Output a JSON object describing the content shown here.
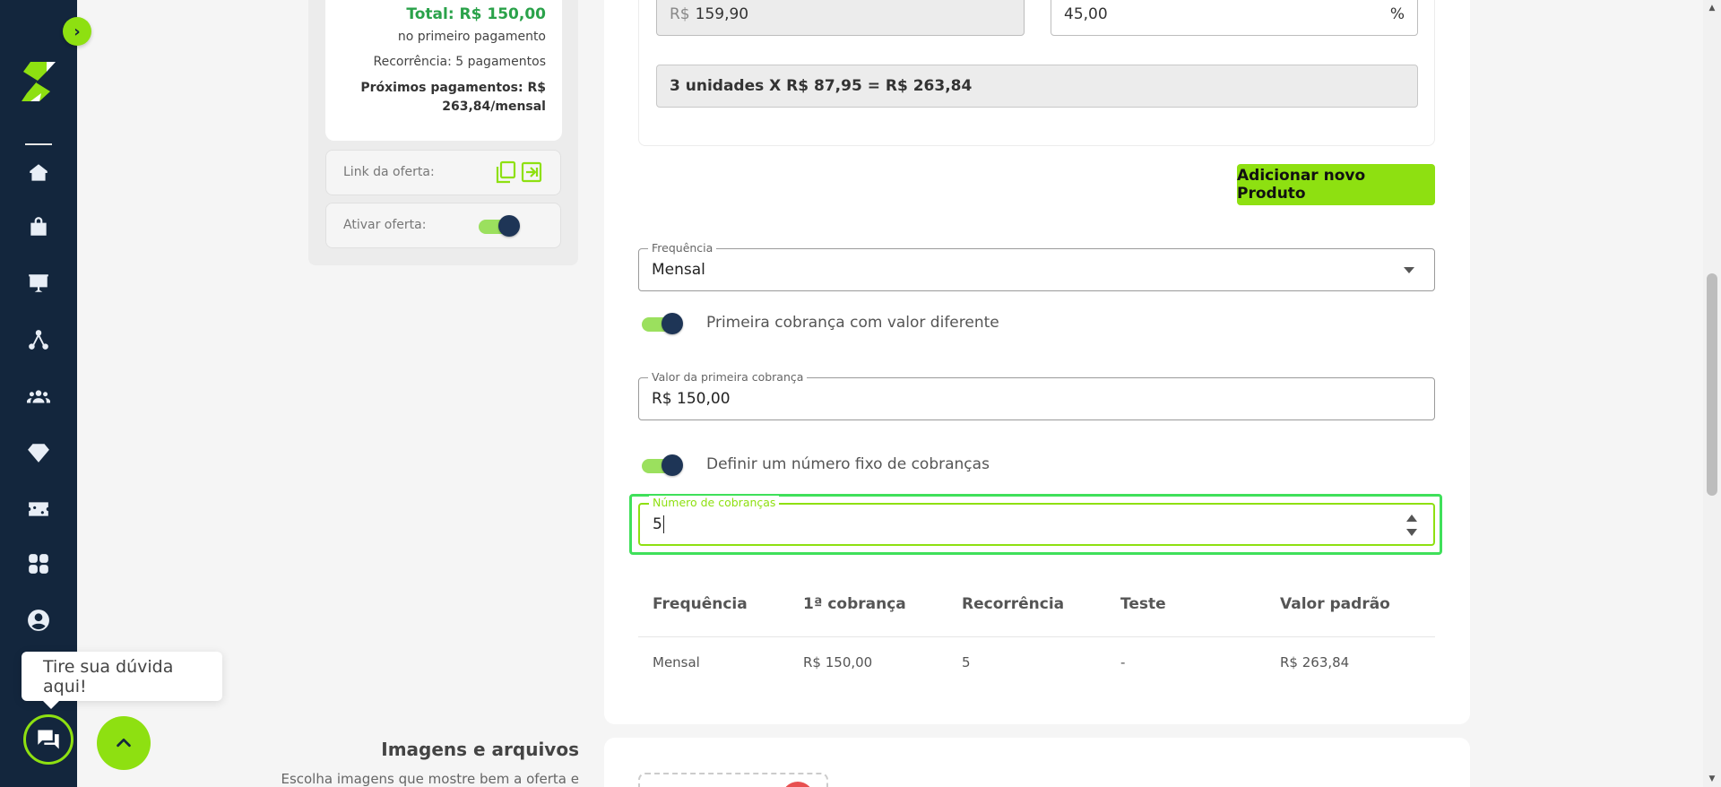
{
  "sidebar": {
    "toggle_icon": "chevron-right-icon",
    "icons": [
      "home-icon",
      "shopping-bag-icon",
      "presentation-chart-icon",
      "network-icon",
      "users-icon",
      "diamond-icon",
      "ticket-icon",
      "apps-grid-icon",
      "user-circle-icon"
    ]
  },
  "summary": {
    "total": "Total: R$ 150,00",
    "first_payment": "no primeiro pagamento",
    "recurrence": "Recorrência: 5 pagamentos",
    "next_line1": "Próximos pagamentos: R$",
    "next_line2": "263,84/mensal",
    "link_label": "Link da oferta:",
    "activate_label": "Ativar oferta:"
  },
  "product": {
    "price_prefix": "R$",
    "price_value": "159,90",
    "discount_value": "45,00",
    "discount_suffix": "%",
    "calc": "3 unidades X R$ 87,95 = R$ 263,84",
    "add_button": "Adicionar novo Produto"
  },
  "frequency": {
    "legend": "Frequência",
    "value": "Mensal"
  },
  "first_charge_toggle": "Primeira cobrança com valor diferente",
  "first_charge": {
    "legend": "Valor da primeira cobrança",
    "value": "R$ 150,00"
  },
  "fixed_charges_toggle": "Definir um número fixo de cobranças",
  "charges_count": {
    "legend": "Número de cobranças",
    "value": "5"
  },
  "table": {
    "headers": [
      "Frequência",
      "1ª cobrança",
      "Recorrência",
      "Teste",
      "Valor padrão"
    ],
    "row": [
      "Mensal",
      "R$ 150,00",
      "5",
      "-",
      "R$ 263,84"
    ]
  },
  "images_section": {
    "title": "Imagens e arquivos",
    "subtitle": "Escolha imagens que mostre bem a oferta e"
  },
  "chat": {
    "tooltip": "Tire sua dúvida aqui!"
  },
  "colors": {
    "sidebar": "#13263d",
    "accent": "#8ee011",
    "total_green": "#2aa24a",
    "focus_ring": "#3fe05a"
  }
}
